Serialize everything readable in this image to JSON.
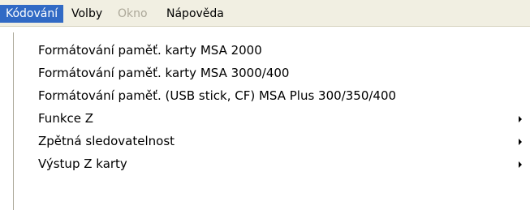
{
  "menubar": {
    "items": [
      {
        "label": "Kódování"
      },
      {
        "label": "Volby"
      },
      {
        "label": "Okno"
      },
      {
        "label": "Nápověda"
      }
    ]
  },
  "dropdown": {
    "items": [
      {
        "label": "Formátování paměť. karty MSA 2000"
      },
      {
        "label": "Formátování paměť. karty MSA 3000/400"
      },
      {
        "label": "Formátování paměť. (USB stick, CF) MSA Plus 300/350/400"
      },
      {
        "label": "Funkce Z",
        "submenu_icon": "submenu-arrow-icon"
      },
      {
        "label": "Zpětná sledovatelnost",
        "submenu_icon": "submenu-arrow-icon"
      },
      {
        "label": "Výstup Z karty",
        "submenu_icon": "submenu-arrow-icon"
      }
    ]
  },
  "colors": {
    "highlight": "#316ac5",
    "menubar_bg": "#f1efe2",
    "disabled_text": "#aca899"
  }
}
